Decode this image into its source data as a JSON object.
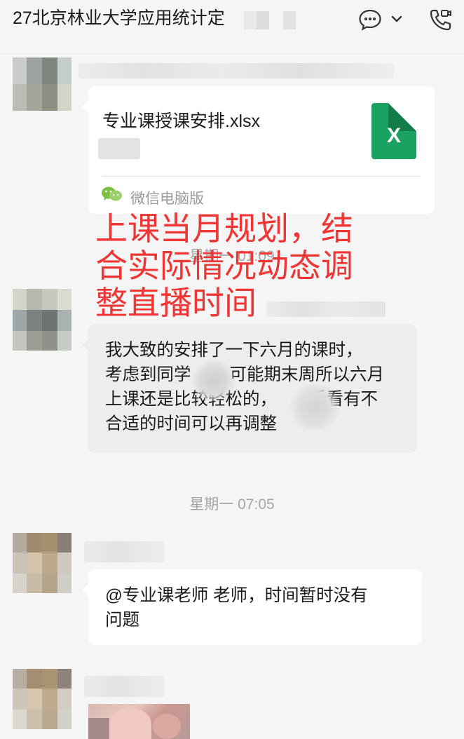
{
  "header": {
    "title": "27北京林业大学应用统计定",
    "icons": [
      "chat-bubble-icon",
      "chevron-down-icon",
      "video-call-icon"
    ]
  },
  "messages": {
    "file_card": {
      "file_name": "专业课授课安排.xlsx",
      "file_icon_letter": "X",
      "file_icon_color": "#1aa260",
      "source_label": "微信电脑版"
    },
    "timestamp_1": "星期一 01:09",
    "text_1_lines": [
      "我大致的安排了一下六月的课时，",
      "考虑到同学",
      "可能期末周所以六月",
      "上课还是比较轻松的，",
      "看看有不",
      "合适的时间可以再调整"
    ],
    "timestamp_2": "星期一 07:05",
    "text_2_lines": [
      "@专业课老师 老师，时间暂时没有",
      "问题"
    ]
  },
  "annotation": {
    "color": "#f03535",
    "lines": [
      "上课当月规划，结",
      "合实际情况动态调",
      "整直播时间"
    ]
  }
}
